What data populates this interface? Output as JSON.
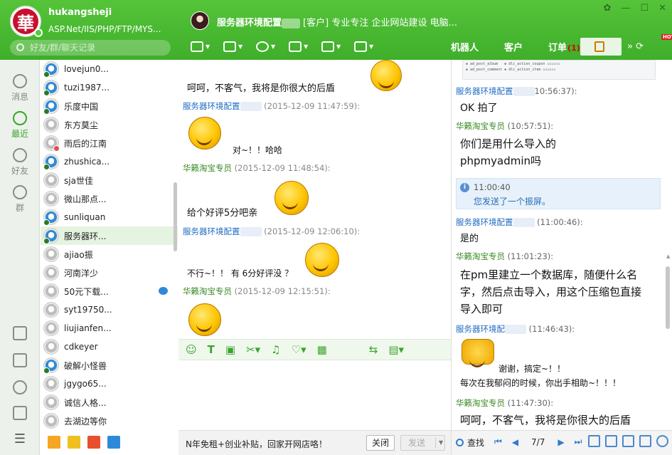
{
  "profile": {
    "name": "hukangsheji",
    "signature": "ASP.Net/IIS/PHP/FTP/MYS...",
    "avatar_char": "華"
  },
  "search": {
    "placeholder": "好友/群/聊天记录"
  },
  "chat_header": {
    "name": "服务器环境配置",
    "tag": "[客户]",
    "desc": "专业专注 企业网站建设 电脑..."
  },
  "right_tabs": [
    {
      "label": "机器人"
    },
    {
      "label": "客户"
    },
    {
      "label": "订单",
      "count": "(1)"
    }
  ],
  "left_nav": [
    {
      "label": "消息",
      "icon": "message-icon"
    },
    {
      "label": "最近",
      "icon": "recent-icon"
    },
    {
      "label": "好友",
      "icon": "friends-icon"
    },
    {
      "label": "群",
      "icon": "group-icon"
    }
  ],
  "contacts": [
    {
      "name": "lovejun0...",
      "online": true
    },
    {
      "name": "tuzi1987...",
      "online": true
    },
    {
      "name": "乐度中国",
      "online": true
    },
    {
      "name": "东方莫尘",
      "online": false
    },
    {
      "name": "雨后的江南",
      "online": false
    },
    {
      "name": "zhushica...",
      "online": true
    },
    {
      "name": "sja世佳",
      "online": false
    },
    {
      "name": "微山那点...",
      "online": false
    },
    {
      "name": "sunliquan",
      "online": true
    },
    {
      "name": "服务器环...",
      "online": true,
      "selected": true
    },
    {
      "name": "ajiao振",
      "online": false
    },
    {
      "name": "河南洋少",
      "online": false
    },
    {
      "name": "50元下载...",
      "online": false,
      "mail": true
    },
    {
      "name": "syt19750...",
      "online": false
    },
    {
      "name": "liujianfen...",
      "online": false
    },
    {
      "name": "cdkeyer",
      "online": false
    },
    {
      "name": "破解小怪兽",
      "online": true
    },
    {
      "name": "jgygo65...",
      "online": false
    },
    {
      "name": "诚信人格...",
      "online": false
    },
    {
      "name": "去湖边等你",
      "online": false
    }
  ],
  "chat": {
    "m1": "呵呵，不客气，我将是你很大的后盾",
    "s1_name": "服务器环境配置",
    "s1_time": "(2015-12-09 11:47:59):",
    "m2": "对~！！哈哈",
    "s2_name": "华籁淘宝专员",
    "s2_time": "(2015-12-09 11:48:54):",
    "m3": "给个好评5分吧亲",
    "s3_name": "服务器环境配置",
    "s3_time": "(2015-12-09 12:06:10):",
    "m4": "不行~！！ 有 6分好评没 ？",
    "s4_name": "华籁淘宝专员",
    "s4_time": "(2015-12-09 12:15:51):"
  },
  "bottom": {
    "ad": "N年免租+创业补贴，回家开网店咯！",
    "close": "关闭",
    "send": "发送"
  },
  "history": {
    "h1_name": "服务器环境配置",
    "h1_time": "10:56:37):",
    "h1_msg": "OK 拍了",
    "h2_name": "华籁淘宝专员",
    "h2_time": "(10:57:51):",
    "h2_msg": "你们是用什么导入的\nphpmyadmin吗",
    "notice_time": "11:00:40",
    "notice_text": "您发送了一个振屏。",
    "h3_name": "服务器环境配置",
    "h3_time": "(11:00:46):",
    "h3_msg": "是的",
    "h4_name": "华籁淘宝专员",
    "h4_time": "(11:01:23):",
    "h4_msg": "在pm里建立一个数据库，随便什么名\n字，然后点击导入，用这个压缩包直接\n导入即可",
    "h5_name": "服务器环境配",
    "h5_time": "(11:46:43):",
    "h5_msg1": "谢谢，搞定~！！",
    "h5_msg2": "每次在我郁闷的时候，你出手相助~！！！",
    "h6_name": "华籁淘宝专员",
    "h6_time": "(11:47:30):",
    "h6_msg": "呵呵，不客气，我将是你很大的后盾",
    "find": "查找",
    "page": "7/7"
  },
  "colors": {
    "brand": "#4cb936",
    "link": "#1e6bc0",
    "sender_green": "#3a8a24"
  }
}
